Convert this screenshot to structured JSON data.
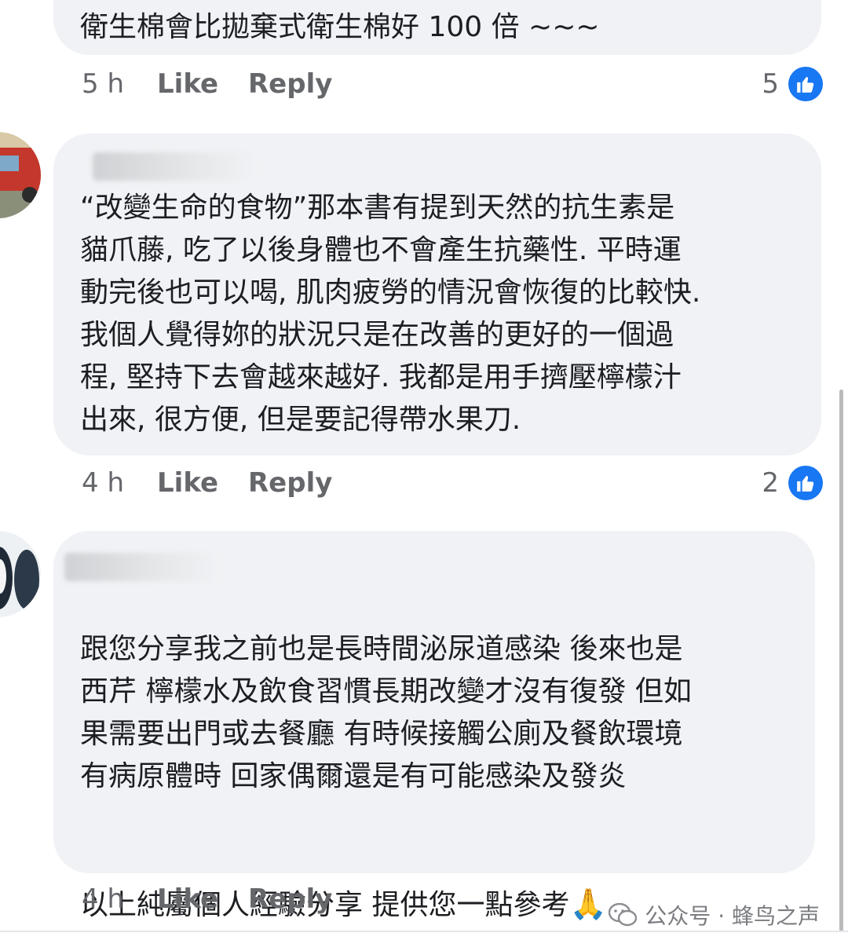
{
  "comments": [
    {
      "text": "衛生棉會比拋棄式衛生棉好 100 倍 ~~~",
      "time": "5 h",
      "like": "Like",
      "reply": "Reply",
      "reaction_count": "5"
    },
    {
      "text": "“改變生命的食物”那本書有提到天然的抗生素是\n貓爪藤, 吃了以後身體也不會產生抗藥性. 平時運\n動完後也可以喝, 肌肉疲勞的情況會恢復的比較快.\n我個人覺得妳的狀況只是在改善的更好的一個過\n程, 堅持下去會越來越好. 我都是用手擠壓檸檬汁\n出來, 很方便, 但是要記得帶水果刀.",
      "time": "4 h",
      "like": "Like",
      "reply": "Reply",
      "reaction_count": "2"
    },
    {
      "text": "跟您分享我之前也是長時間泌尿道感染 後來也是\n西芹 檸檬水及飲食習慣長期改變才沒有復發 但如\n果需要出門或去餐廳 有時候接觸公廁及餐飲環境\n有病原體時 回家偶爾還是有可能感染及發炎\n\n\n以上純屬個人經驗分享 提供您一點參考",
      "emoji": "🙏",
      "time": "4 h",
      "like": "Like",
      "reply": "Reply"
    }
  ],
  "watermark": {
    "text": "公众号 · 蜂鸟之声",
    "icon": "wechat-icon"
  },
  "colors": {
    "bubble": "#f0f2f5",
    "meta_text": "#65676b",
    "like_blue": "#1877f2"
  }
}
